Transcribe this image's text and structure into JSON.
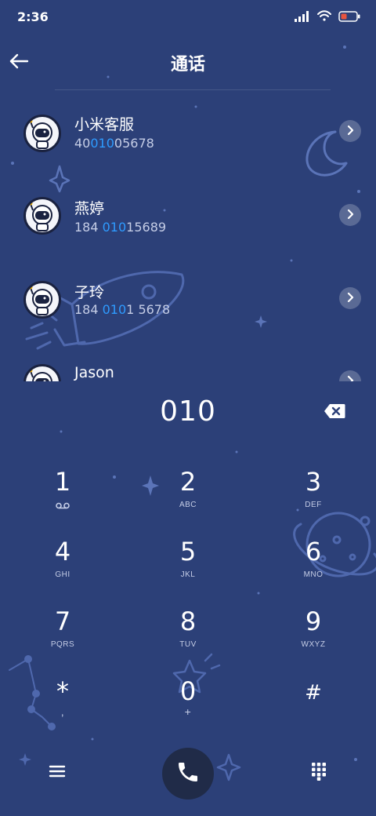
{
  "status_bar": {
    "time": "2:36",
    "icons": [
      "signal-icon",
      "wifi-icon",
      "battery-icon"
    ]
  },
  "header": {
    "title": "通话",
    "back_icon": "back-arrow-icon"
  },
  "contacts": [
    {
      "name": "小米客服",
      "number_pre": "40",
      "number_match": "010",
      "number_post": "05678"
    },
    {
      "name": "燕婷",
      "number_pre": "184 ",
      "number_match": "010",
      "number_post": "15689"
    },
    {
      "name": "子玲",
      "number_pre": "184 ",
      "number_match": "010",
      "number_post": "1 5678"
    },
    {
      "name": "Jason",
      "number_pre": "",
      "number_match": "",
      "number_post": ""
    }
  ],
  "dialer": {
    "dialed_number": "010",
    "backspace_icon": "backspace-icon"
  },
  "keypad": [
    {
      "digit": "1",
      "letters": "",
      "sub_icon": "voicemail-icon"
    },
    {
      "digit": "2",
      "letters": "ABC"
    },
    {
      "digit": "3",
      "letters": "DEF"
    },
    {
      "digit": "4",
      "letters": "GHI"
    },
    {
      "digit": "5",
      "letters": "JKL"
    },
    {
      "digit": "6",
      "letters": "MNO"
    },
    {
      "digit": "7",
      "letters": "PQRS"
    },
    {
      "digit": "8",
      "letters": "TUV"
    },
    {
      "digit": "9",
      "letters": "WXYZ"
    },
    {
      "digit": "*",
      "letters": ","
    },
    {
      "digit": "0",
      "letters": "+"
    },
    {
      "digit": "#",
      "letters": ""
    }
  ],
  "bottom_bar": {
    "menu_icon": "menu-icon",
    "call_icon": "phone-icon",
    "keypad_icon": "dialpad-icon"
  },
  "colors": {
    "background": "#2c4078",
    "highlight": "#2e9bff",
    "secondary_text": "#c5cde6",
    "call_button": "#202b48"
  }
}
